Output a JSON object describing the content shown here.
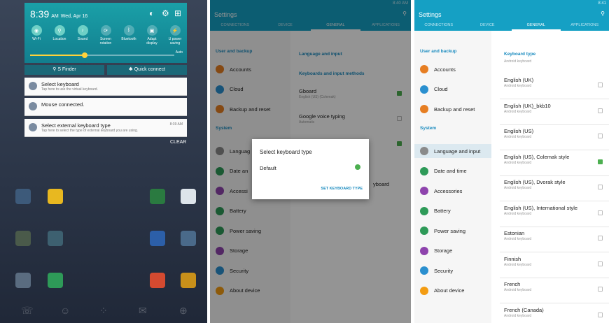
{
  "panel1": {
    "time": "8:39",
    "time_suffix": "AM",
    "date": "Wed, Apr 16",
    "status_time": "8:39 AM",
    "quick_settings": [
      "Wi-Fi",
      "Location",
      "Sound",
      "Screen rotation",
      "Bluetooth",
      "Adapt display",
      "U power saving"
    ],
    "auto_label": "Auto",
    "finder_label": "S Finder",
    "quick_connect_label": "Quick connect",
    "notifications": [
      {
        "title": "Select keyboard",
        "subtitle": "Tap here to use the virtual keyboard.",
        "time": ""
      },
      {
        "title": "Mouse connected.",
        "subtitle": "",
        "time": ""
      },
      {
        "title": "Select external keyboard type",
        "subtitle": "Tap here to select the type of external keyboard you are using.",
        "time": "8:39 AM"
      }
    ],
    "clear_label": "CLEAR"
  },
  "settings_common": {
    "title": "Settings",
    "status": "8:40 AM",
    "status3": "8:41",
    "tabs": [
      "CONNECTIONS",
      "DEVICE",
      "GENERAL",
      "APPLICATIONS"
    ],
    "user_backup": "User and backup",
    "system": "System",
    "menu_user": [
      "Accounts",
      "Cloud",
      "Backup and reset"
    ],
    "menu_system": [
      "Language and input",
      "Date and time",
      "Accessories",
      "Battery",
      "Power saving",
      "Storage",
      "Security",
      "About device"
    ]
  },
  "panel2": {
    "right_header": "Language and input",
    "section": "Keyboards and input methods",
    "gboard": "Gboard",
    "gboard_sub": "English (US) (Colemak)",
    "voice": "Google voice typing",
    "voice_sub": "Automatic",
    "keyboard_partial": "yboard",
    "dialog_title": "Select keyboard type",
    "dialog_default": "Default",
    "dialog_button": "SET KEYBOARD TYPE",
    "truncated_lang": "Languag",
    "truncated_date": "Date an",
    "truncated_acc": "Accessi"
  },
  "panel3": {
    "right_header": "Keyboard type",
    "top_sub": "Android keyboard",
    "items": [
      {
        "name": "English (UK)",
        "sub": "Android keyboard",
        "checked": false
      },
      {
        "name": "English (UK)_bkb10",
        "sub": "Android keyboard",
        "checked": false
      },
      {
        "name": "English (US)",
        "sub": "Android keyboard",
        "checked": false
      },
      {
        "name": "English (US), Colemak style",
        "sub": "Android keyboard",
        "checked": true
      },
      {
        "name": "English (US), Dvorak style",
        "sub": "Android keyboard",
        "checked": false
      },
      {
        "name": "English (US), International style",
        "sub": "Android keyboard",
        "checked": false
      },
      {
        "name": "Estonian",
        "sub": "Android keyboard",
        "checked": false
      },
      {
        "name": "Finnish",
        "sub": "Android keyboard",
        "checked": false
      },
      {
        "name": "French",
        "sub": "Android keyboard",
        "checked": false
      },
      {
        "name": "French (Canada)",
        "sub": "Android keyboard",
        "checked": false
      }
    ]
  },
  "colors": {
    "accent": "#15a0c4",
    "check": "#4caf50"
  }
}
